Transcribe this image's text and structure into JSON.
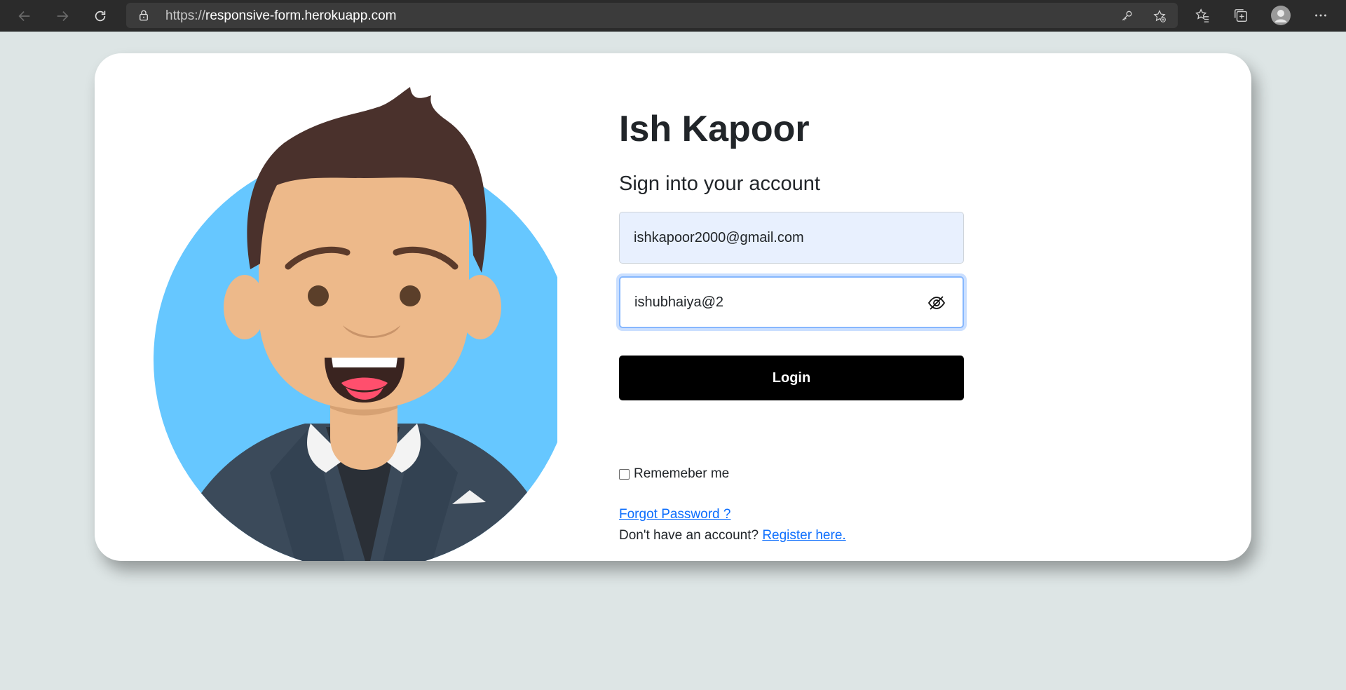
{
  "browser": {
    "url_scheme": "https://",
    "url_host": "responsive-form.herokuapp.com"
  },
  "brand": {
    "name": "Ish Kapoor"
  },
  "form": {
    "subtitle": "Sign into your account",
    "email_value": "ishkapoor2000@gmail.com",
    "password_value": "ishubhaiya@2",
    "login_label": "Login",
    "remember_label": "Rememeber me",
    "remember_checked": false,
    "forgot_label": "Forgot Password ?",
    "register_prompt": "Don't have an account? ",
    "register_label": "Register here."
  },
  "colors": {
    "page_bg": "#dde5e5",
    "link": "#0d6efd",
    "button_bg": "#000000",
    "avatar_circle": "#66c7ff"
  },
  "icons": {
    "back": "arrow-left-icon",
    "forward": "arrow-right-icon",
    "reload": "refresh-icon",
    "lock": "lock-icon",
    "password_toggle": "eye-slash-icon"
  }
}
